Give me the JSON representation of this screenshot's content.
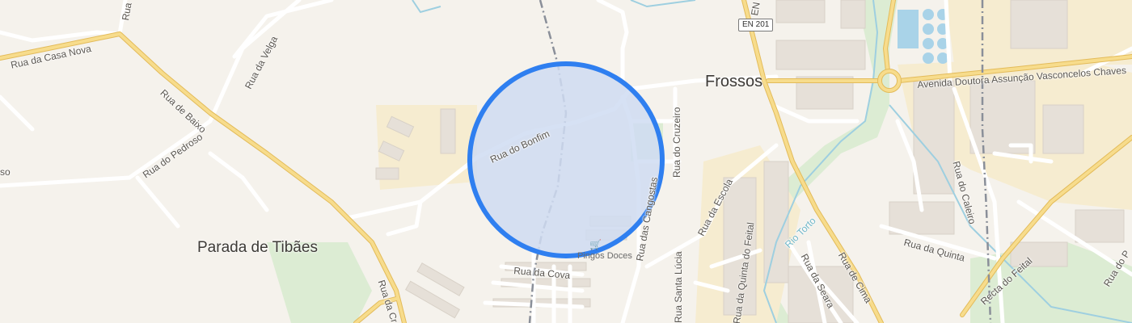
{
  "map": {
    "places": {
      "frossos": "Frossos",
      "parada": "Parada de Tibães"
    },
    "route_shield": "EN 201",
    "streets": {
      "casa_nova": "Rua da Casa Nova",
      "velga": "Rua da Velga",
      "baixo": "Rua de Baixo",
      "pedroso": "Rua do Pedroso",
      "pedroso_partial": "so",
      "bonfim": "Rua do Bonfim",
      "cruzeiro": "Rua do Cruzeiro",
      "cangostas": "Rua das Cangostas",
      "cova": "Rua da Cova",
      "escola": "Rua da Escola",
      "quinta_feital": "Rua da Quinta do Feital",
      "lucia": "Rua Santa Lúcia",
      "seara": "Rua da Seara",
      "cima": "Rua de Cima",
      "quinta": "Rua da Quinta",
      "caleiro": "Rua do Caleiro",
      "recta_feital": "Recta do Feital",
      "avenida": "Avenida Doutora Assunção Vasconcelos Chaves",
      "cruz_partial": "Rua da Cr",
      "top_partial": "Rua",
      "right_partial": "Rua do P"
    },
    "waterway": "Rio Torto",
    "poi": {
      "supermarket_icon": "shopping-cart-icon",
      "supermarket_label": "Pingos Doces"
    },
    "highlight": {
      "fill": "#cfdcf2",
      "stroke": "#2f7ff0"
    },
    "colors": {
      "background": "#f5f2ec",
      "major_road": "#f3d27a",
      "minor_road": "#ffffff",
      "railway": "#8a8f99",
      "water": "#9ecfe0",
      "green": "#d7ead0",
      "building": "#e7e2db"
    }
  }
}
